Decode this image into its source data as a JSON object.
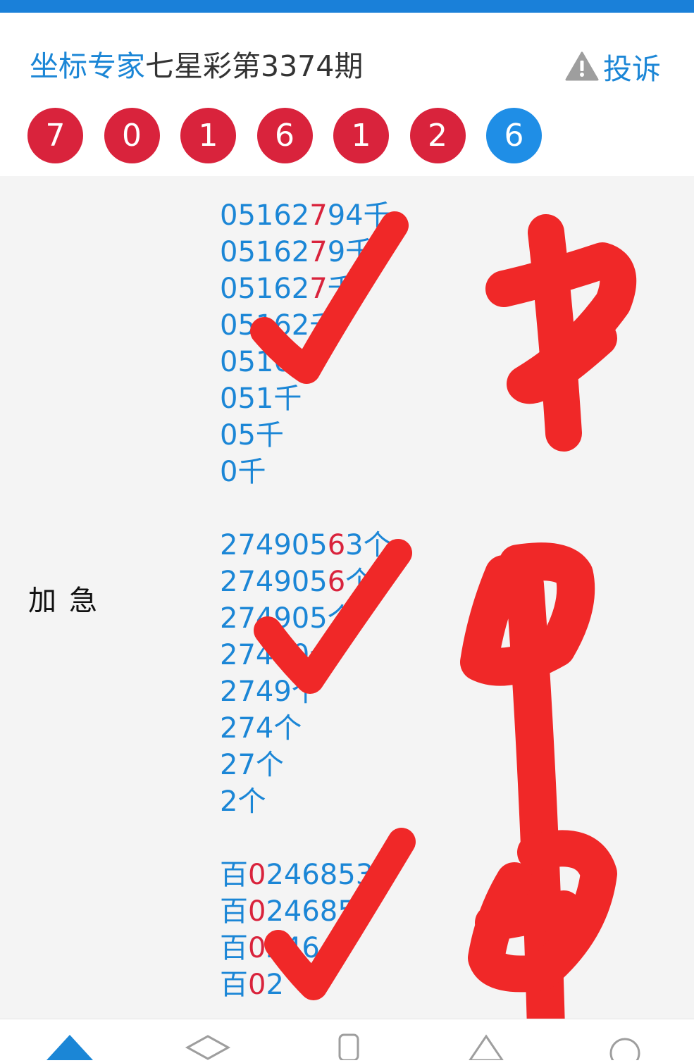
{
  "header": {
    "brand": "坐标专家",
    "issue": "七星彩第3374期",
    "report_label": "投诉",
    "report_icon": "warning-icon"
  },
  "draw_numbers": [
    {
      "value": "7",
      "color": "red"
    },
    {
      "value": "0",
      "color": "red"
    },
    {
      "value": "1",
      "color": "red"
    },
    {
      "value": "6",
      "color": "red"
    },
    {
      "value": "1",
      "color": "red"
    },
    {
      "value": "2",
      "color": "red"
    },
    {
      "value": "6",
      "color": "blue"
    }
  ],
  "colors": {
    "accent_blue": "#1b86d6",
    "ball_red": "#d9233c",
    "ball_blue": "#1f8ee6",
    "highlight_red": "#d9233c",
    "annotation_red": "#f02828"
  },
  "content": {
    "label": "加急",
    "groups": [
      {
        "lines": [
          {
            "pre": "05162",
            "hl": "7",
            "post": "94千"
          },
          {
            "pre": "05162",
            "hl": "7",
            "post": "9千"
          },
          {
            "pre": "05162",
            "hl": "7",
            "post": "千"
          },
          {
            "pre": "05162千",
            "hl": "",
            "post": ""
          },
          {
            "pre": "0516千",
            "hl": "",
            "post": ""
          },
          {
            "pre": "051千",
            "hl": "",
            "post": ""
          },
          {
            "pre": "05千",
            "hl": "",
            "post": ""
          },
          {
            "pre": "0千",
            "hl": "",
            "post": ""
          }
        ]
      },
      {
        "lines": [
          {
            "pre": "274905",
            "hl": "6",
            "post": "3个"
          },
          {
            "pre": "274905",
            "hl": "6",
            "post": "个"
          },
          {
            "pre": "274905个",
            "hl": "",
            "post": ""
          },
          {
            "pre": "27490个",
            "hl": "",
            "post": ""
          },
          {
            "pre": "2749个",
            "hl": "",
            "post": ""
          },
          {
            "pre": "274个",
            "hl": "",
            "post": ""
          },
          {
            "pre": "27个",
            "hl": "",
            "post": ""
          },
          {
            "pre": "2个",
            "hl": "",
            "post": ""
          }
        ]
      },
      {
        "lines": [
          {
            "pre": "百",
            "hl": "0",
            "post": "2468537"
          },
          {
            "pre": "百",
            "hl": "0",
            "post": "24685"
          },
          {
            "pre": "百",
            "hl": "0",
            "post": "246"
          },
          {
            "pre": "百",
            "hl": "0",
            "post": "2"
          }
        ]
      }
    ]
  },
  "annotations": {
    "checkmarks": 3,
    "handwriting": [
      "中",
      "中",
      "中"
    ]
  },
  "tabbar": {
    "tabs": [
      {
        "icon": "home-icon"
      },
      {
        "icon": "graduation-cap-icon"
      },
      {
        "icon": "phone-icon"
      },
      {
        "icon": "triangle-icon"
      },
      {
        "icon": "circle-icon"
      }
    ]
  }
}
